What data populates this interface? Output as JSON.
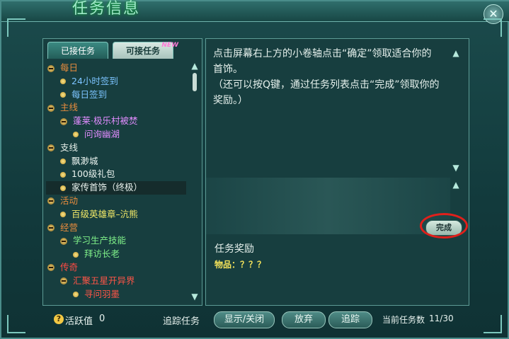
{
  "window": {
    "title": "任务信息"
  },
  "tabs": [
    {
      "label": "已接任务",
      "active": true
    },
    {
      "label": "可接任务",
      "active": false,
      "badge": "NEW"
    }
  ],
  "tree": [
    {
      "label": "每日",
      "level": 0,
      "kind": "category",
      "color": "c-cat-orange"
    },
    {
      "label": "24小时签到",
      "level": 1,
      "kind": "leaf",
      "color": "c-blue"
    },
    {
      "label": "每日签到",
      "level": 1,
      "kind": "leaf",
      "color": "c-blue"
    },
    {
      "label": "主线",
      "level": 0,
      "kind": "category",
      "color": "c-cat-orange"
    },
    {
      "label": "蓬莱·极乐村被焚",
      "level": 1,
      "kind": "category",
      "color": "c-purple"
    },
    {
      "label": "问询幽湖",
      "level": 2,
      "kind": "leaf",
      "color": "c-purple"
    },
    {
      "label": "支线",
      "level": 0,
      "kind": "category",
      "color": "c-cat-white"
    },
    {
      "label": "飘渺城",
      "level": 1,
      "kind": "leaf",
      "color": "c-white"
    },
    {
      "label": "100级礼包",
      "level": 1,
      "kind": "leaf",
      "color": "c-white"
    },
    {
      "label": "家传首饰（终极）",
      "level": 1,
      "kind": "leaf",
      "color": "c-white",
      "selected": true
    },
    {
      "label": "活动",
      "level": 0,
      "kind": "category",
      "color": "c-cat-orange"
    },
    {
      "label": "百级英雄章–沆熊",
      "level": 1,
      "kind": "leaf",
      "color": "c-yellow"
    },
    {
      "label": "经营",
      "level": 0,
      "kind": "category",
      "color": "c-cat-orange"
    },
    {
      "label": "学习生产技能",
      "level": 1,
      "kind": "category",
      "color": "c-green"
    },
    {
      "label": "拜访长老",
      "level": 2,
      "kind": "leaf",
      "color": "c-green"
    },
    {
      "label": "传奇",
      "level": 0,
      "kind": "category",
      "color": "c-cat-red"
    },
    {
      "label": "汇聚五星开异界",
      "level": 1,
      "kind": "category",
      "color": "c-red"
    },
    {
      "label": "寻问羽墨",
      "level": 2,
      "kind": "leaf",
      "color": "c-red"
    }
  ],
  "description": {
    "line1": "点击屏幕右上方的小卷轴点击“确定”领取适合你的首饰。",
    "line2": "（还可以按Q键，通过任务列表点击“完成”领取你的奖励。）"
  },
  "complete_button": "完成",
  "reward": {
    "title": "任务奖励",
    "item": "物品：？？？"
  },
  "bottom": {
    "help_glyph": "?",
    "active_label": "活跃值",
    "active_value": "0",
    "track_label": "追踪任务",
    "toggle_button": "显示/关闭",
    "abandon_button": "放弃",
    "track_button": "追踪",
    "count_label": "当前任务数",
    "count_value": "11/30"
  },
  "icons": {
    "close": "close-icon",
    "scroll_up": "arrow-up-icon",
    "scroll_down": "arrow-down-icon"
  }
}
